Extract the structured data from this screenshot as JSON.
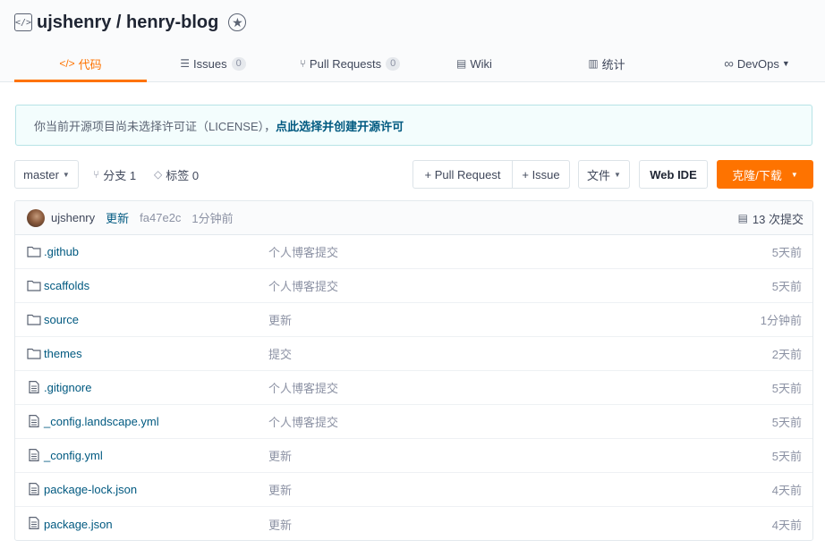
{
  "repo": {
    "owner": "ujshenry",
    "separator": " / ",
    "name": "henry-blog",
    "icon": "code-repo-icon"
  },
  "tabs": [
    {
      "label": "代码",
      "icon": "code-icon",
      "active": true
    },
    {
      "label": "Issues",
      "icon": "issues-icon",
      "count": "0"
    },
    {
      "label": "Pull Requests",
      "icon": "pull-request-icon",
      "count": "0"
    },
    {
      "label": "Wiki",
      "icon": "wiki-icon"
    },
    {
      "label": "统计",
      "icon": "stats-icon"
    },
    {
      "label": "DevOps",
      "icon": "infinity-icon"
    }
  ],
  "notice": {
    "text": "你当前开源项目尚未选择许可证（LICENSE），",
    "link": "点此选择并创建开源许可"
  },
  "toolbar": {
    "branch": "master",
    "branches_label": "分支 1",
    "tags_label": "标签 0",
    "pull_request": "+ Pull Request",
    "issue": "+ Issue",
    "files": "文件",
    "web_ide": "Web IDE",
    "clone": "克隆/下载"
  },
  "commit": {
    "author": "ujshenry",
    "message": "更新",
    "sha": "fa47e2c",
    "time": "1分钟前",
    "count": "13 次提交"
  },
  "files": [
    {
      "type": "folder",
      "name": ".github",
      "message": "个人博客提交",
      "time": "5天前"
    },
    {
      "type": "folder",
      "name": "scaffolds",
      "message": "个人博客提交",
      "time": "5天前"
    },
    {
      "type": "folder",
      "name": "source",
      "message": "更新",
      "time": "1分钟前"
    },
    {
      "type": "folder",
      "name": "themes",
      "message": "提交",
      "time": "2天前"
    },
    {
      "type": "file",
      "name": ".gitignore",
      "message": "个人博客提交",
      "time": "5天前"
    },
    {
      "type": "file",
      "name": "_config.landscape.yml",
      "message": "个人博客提交",
      "time": "5天前"
    },
    {
      "type": "file",
      "name": "_config.yml",
      "message": "更新",
      "time": "5天前"
    },
    {
      "type": "file",
      "name": "package-lock.json",
      "message": "更新",
      "time": "4天前"
    },
    {
      "type": "file",
      "name": "package.json",
      "message": "更新",
      "time": "4天前"
    }
  ],
  "colors": {
    "accent": "#fe7300",
    "link": "#005980",
    "muted": "#8c92a4"
  }
}
